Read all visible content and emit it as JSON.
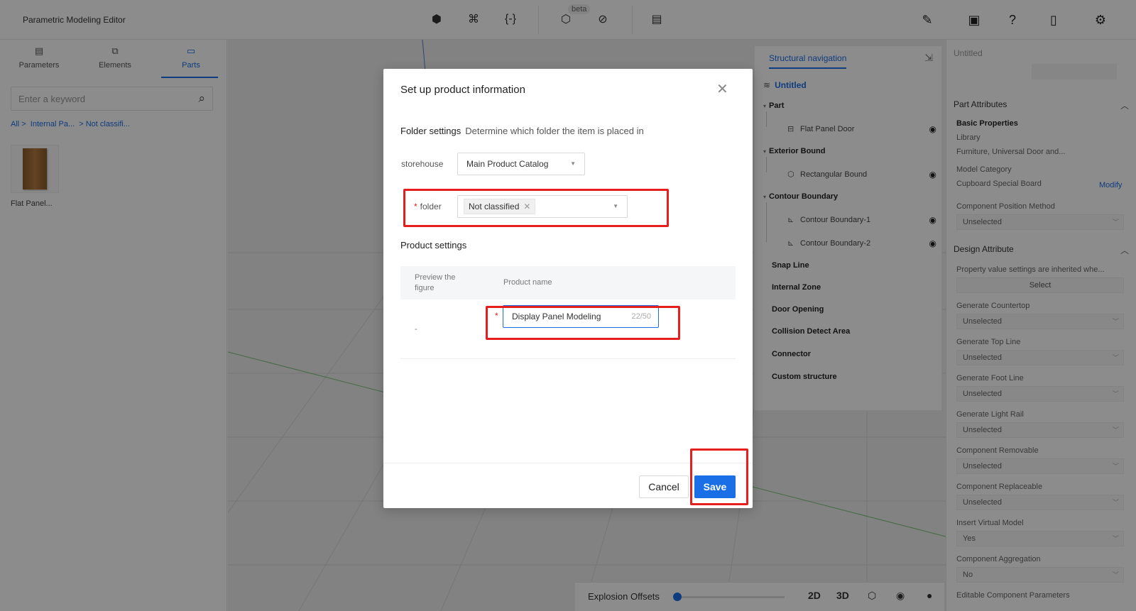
{
  "app": {
    "title": "Parametric Modeling Editor"
  },
  "toolbar": {
    "icons": [
      "cube-gear-icon",
      "grid-cross-icon",
      "brackets-icon",
      "cube-settings-icon",
      "link-icon",
      "document-arrow-icon"
    ],
    "beta_label": "beta",
    "right_icons": [
      "pencil-icon",
      "monitor-chart-icon",
      "help-icon",
      "file-icon",
      "gear-icon"
    ]
  },
  "left_panel": {
    "tabs": [
      {
        "label": "Parameters",
        "icon": "document-icon"
      },
      {
        "label": "Elements",
        "icon": "elements-icon"
      },
      {
        "label": "Parts",
        "icon": "folder-icon",
        "active": true
      }
    ],
    "search_placeholder": "Enter a keyword",
    "breadcrumb": [
      "All >",
      "Internal Pa...",
      "> Not classifi..."
    ],
    "parts": [
      {
        "name": "Flat Panel..."
      }
    ]
  },
  "viewport": {
    "bottom_bar": {
      "explosion_label": "Explosion Offsets",
      "view_2d": "2D",
      "view_3d": "3D",
      "slider_value": 0
    }
  },
  "structural_nav": {
    "title": "Structural navigation",
    "root": "Untitled",
    "groups": [
      {
        "label": "Part",
        "children": [
          "Flat Panel Door"
        ]
      },
      {
        "label": "Exterior Bound",
        "children": [
          "Rectangular Bound"
        ]
      },
      {
        "label": "Contour Boundary",
        "children": [
          "Contour Boundary-1",
          "Contour Boundary-2"
        ]
      },
      {
        "label": "Snap Line"
      },
      {
        "label": "Internal Zone"
      },
      {
        "label": "Door Opening"
      },
      {
        "label": "Collision Detect Area"
      },
      {
        "label": "Connector"
      },
      {
        "label": "Custom structure"
      }
    ]
  },
  "right_panel": {
    "title": "Untitled",
    "part_attributes": "Part Attributes",
    "basic_properties": "Basic Properties",
    "library_label": "Library",
    "library_value": "Furniture, Universal Door and...",
    "model_category_label": "Model Category",
    "model_category_value": "Cupboard Special Board",
    "modify_link": "Modify",
    "position_method_label": "Component Position Method",
    "position_method_value": "Unselected",
    "design_attribute": "Design Attribute",
    "inherit_note": "Property value settings are inherited whe...",
    "select_button": "Select",
    "fields": [
      {
        "label": "Generate Countertop",
        "value": "Unselected"
      },
      {
        "label": "Generate Top Line",
        "value": "Unselected"
      },
      {
        "label": "Generate Foot Line",
        "value": "Unselected"
      },
      {
        "label": "Generate Light Rail",
        "value": "Unselected"
      },
      {
        "label": "Component Removable",
        "value": "Unselected"
      },
      {
        "label": "Component Replaceable",
        "value": "Unselected"
      },
      {
        "label": "Insert Virtual Model",
        "value": "Yes"
      },
      {
        "label": "Component Aggregation",
        "value": "No"
      }
    ],
    "editable_params": "Editable Component Parameters"
  },
  "modal": {
    "title": "Set up product information",
    "folder_settings": "Folder settings",
    "folder_settings_desc": "Determine which folder the item is placed in",
    "storehouse_label": "storehouse",
    "storehouse_value": "Main Product Catalog",
    "folder_label": "folder",
    "folder_tag": "Not classified",
    "product_settings": "Product settings",
    "col_preview": "Preview the figure",
    "col_name": "Product name",
    "preview_value": "-",
    "product_name_value": "Display Panel Modeling",
    "product_name_count": "22/50",
    "cancel_label": "Cancel",
    "save_label": "Save"
  }
}
